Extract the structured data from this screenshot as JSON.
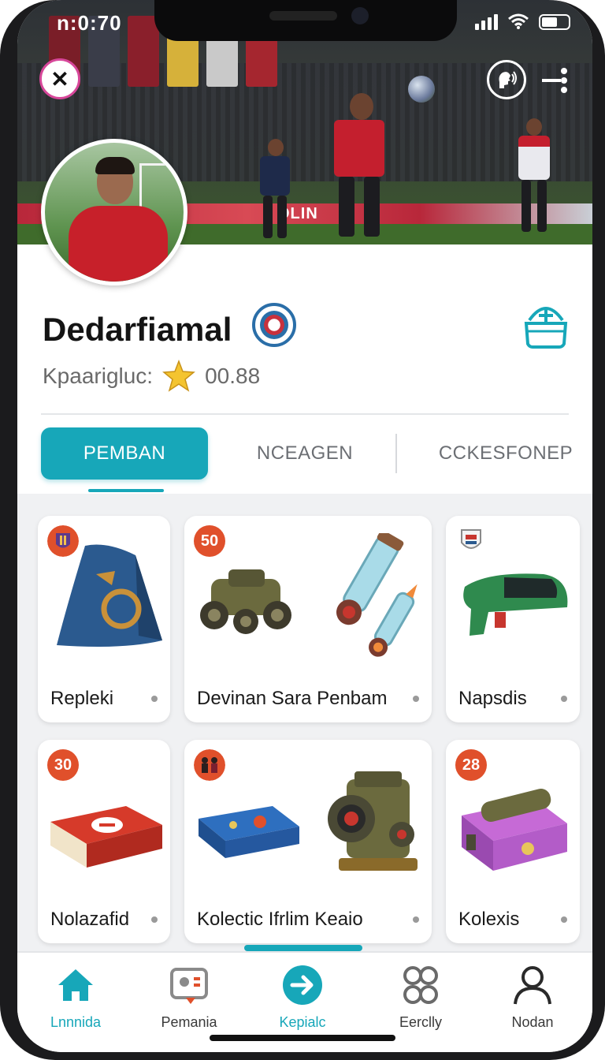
{
  "status_bar": {
    "time": "n:0:70"
  },
  "profile": {
    "name": "Dedarfiamal",
    "rating_label": "Kpaarigluc:",
    "rating_value": "00.88"
  },
  "tabs": [
    {
      "label": "PEMBAN",
      "active": true
    },
    {
      "label": "NCEAGEN",
      "active": false
    },
    {
      "label": "CCKESFONEP",
      "active": false
    }
  ],
  "items": [
    {
      "label": "Repleki",
      "badge": "",
      "icon": "team-crest-icon"
    },
    {
      "label": "Devinan Sara Penbam",
      "badge": "50",
      "icon": ""
    },
    {
      "label": "Napsdis",
      "badge": "",
      "icon": "shield-crest-icon"
    },
    {
      "label": "Nolazafid",
      "badge": "30",
      "icon": ""
    },
    {
      "label": "Kolectic Ifrlim Keaio",
      "badge": "",
      "icon": "players-icon"
    },
    {
      "label": "Kolexis",
      "badge": "28",
      "icon": ""
    }
  ],
  "ad_board_text": "OLIN",
  "bottom_nav": [
    {
      "label": "Lnnnida",
      "icon": "home-icon",
      "active": true
    },
    {
      "label": "Pemania",
      "icon": "photo-card-icon",
      "active": false
    },
    {
      "label": "Kepialc",
      "icon": "arrow-circle-icon",
      "active": true
    },
    {
      "label": "Eerclly",
      "icon": "gears-icon",
      "active": false
    },
    {
      "label": "Nodan",
      "icon": "user-icon",
      "active": false
    }
  ],
  "colors": {
    "accent": "#17a7b9",
    "badge": "#e0502b",
    "close_ring": "#d7479a"
  }
}
